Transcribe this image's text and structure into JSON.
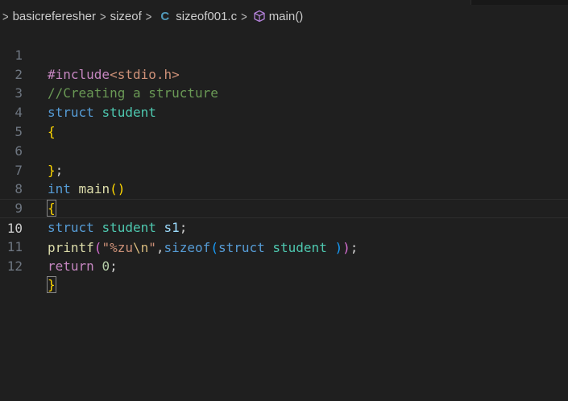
{
  "breadcrumb": {
    "items": [
      "basicreferesher",
      "sizeof",
      "sizeof001.c",
      "main()"
    ],
    "file_icon_glyph": "C",
    "file_icon": "c-language-icon",
    "symbol_icon": "method-cube-icon"
  },
  "editor": {
    "current_line": 10,
    "lines": [
      {
        "n": "1",
        "t": {
          "a": "#include",
          "b": "<stdio.h>"
        }
      },
      {
        "n": "2",
        "t": {
          "a": "//Creating a structure"
        }
      },
      {
        "n": "3",
        "t": {
          "a": "struct",
          "b": " ",
          "c": "student"
        }
      },
      {
        "n": "4",
        "t": {
          "a": "{"
        }
      },
      {
        "n": "5",
        "t": {}
      },
      {
        "n": "6",
        "t": {
          "a": "}",
          "b": ";"
        }
      },
      {
        "n": "7",
        "t": {
          "a": "int",
          "b": " ",
          "c": "main",
          "d": "()"
        }
      },
      {
        "n": "8",
        "t": {
          "a": "{"
        }
      },
      {
        "n": "9",
        "t": {
          "a": "struct",
          "b": " ",
          "c": "student",
          "d": " ",
          "e": "s1",
          "f": ";"
        }
      },
      {
        "n": "10",
        "t": {
          "a": "printf",
          "b": "(",
          "c": "\"%zu",
          "d": "\\n",
          "e": "\"",
          "f": ",",
          "g": "sizeof",
          "h": "(",
          "i": "struct",
          "j": " ",
          "k": "student",
          "l": " ",
          "m": ")",
          "n": ")",
          "o": ";"
        }
      },
      {
        "n": "11",
        "t": {
          "a": "return",
          "b": " ",
          "c": "0",
          "d": ";"
        }
      },
      {
        "n": "12",
        "t": {
          "a": "}"
        }
      }
    ]
  },
  "colors": {
    "background": "#1f1f1f",
    "keyword": "#569cd6",
    "type": "#4ec9b0",
    "function": "#dcdcaa",
    "string": "#ce9178",
    "comment": "#6a9955",
    "preprocessor": "#c586c0",
    "bracket_level1": "#ffd700",
    "bracket_level2": "#da70d6",
    "bracket_level3": "#179fff"
  }
}
